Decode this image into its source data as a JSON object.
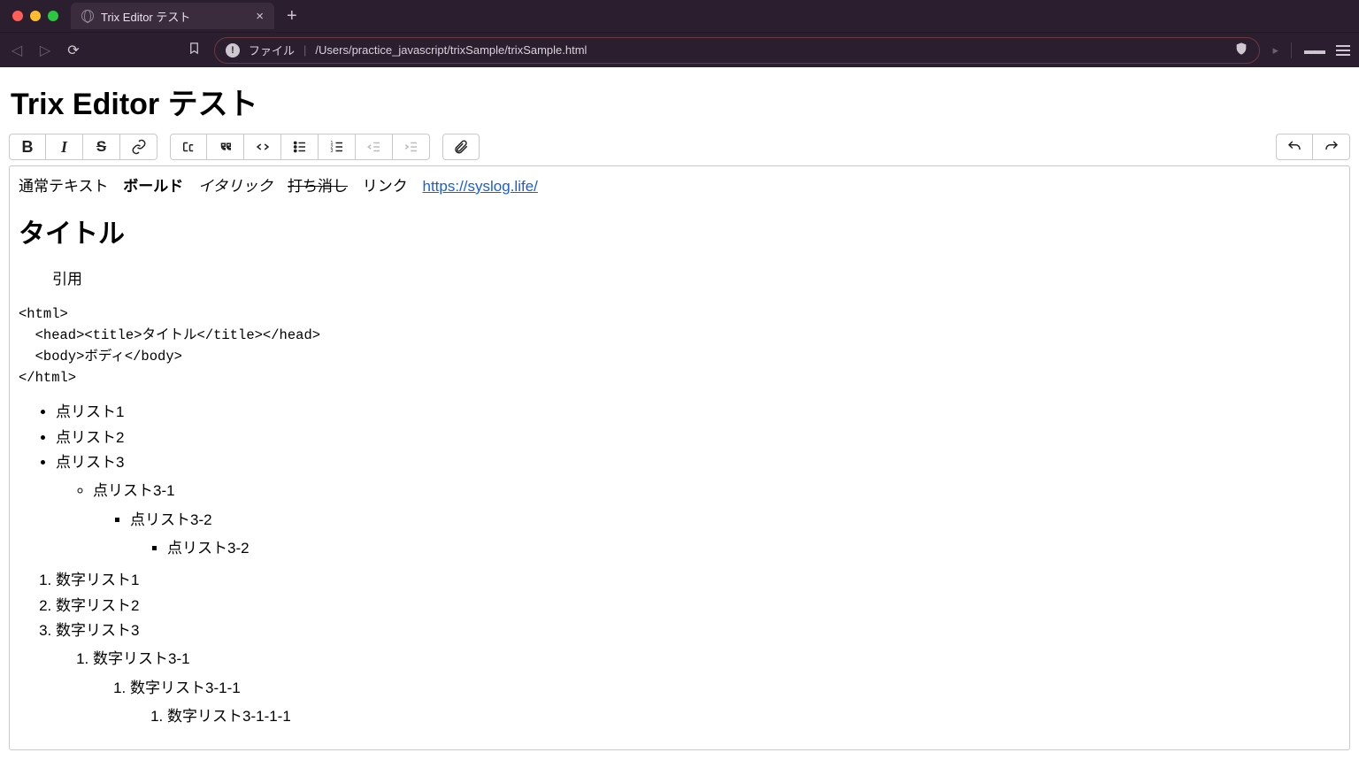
{
  "browser": {
    "tab_title": "Trix Editor テスト",
    "address_label": "ファイル",
    "address_path": "/Users/practice_javascript/trixSample/trixSample.html"
  },
  "page": {
    "heading": "Trix Editor テスト"
  },
  "toolbar": {
    "bold": "B",
    "italic": "I",
    "strike": "S"
  },
  "content": {
    "normal_label": "通常テキスト",
    "bold_label": "ボールド",
    "italic_label": "イタリック",
    "strike_label": "打ち消し",
    "link_label": "リンク",
    "link_href": "https://syslog.life/",
    "h1": "タイトル",
    "quote": "引用",
    "code": "<html>\n  <head><title>タイトル</title></head>\n  <body>ボディ</body>\n</html>",
    "ul": {
      "i1": "点リスト1",
      "i2": "点リスト2",
      "i3": "点リスト3",
      "i3_1": "点リスト3-1",
      "i3_2": "点リスト3-2",
      "i3_2b": "点リスト3-2"
    },
    "ol": {
      "i1": "数字リスト1",
      "i2": "数字リスト2",
      "i3": "数字リスト3",
      "i3_1": "数字リスト3-1",
      "i3_1_1": "数字リスト3-1-1",
      "i3_1_1_1": "数字リスト3-1-1-1"
    }
  }
}
